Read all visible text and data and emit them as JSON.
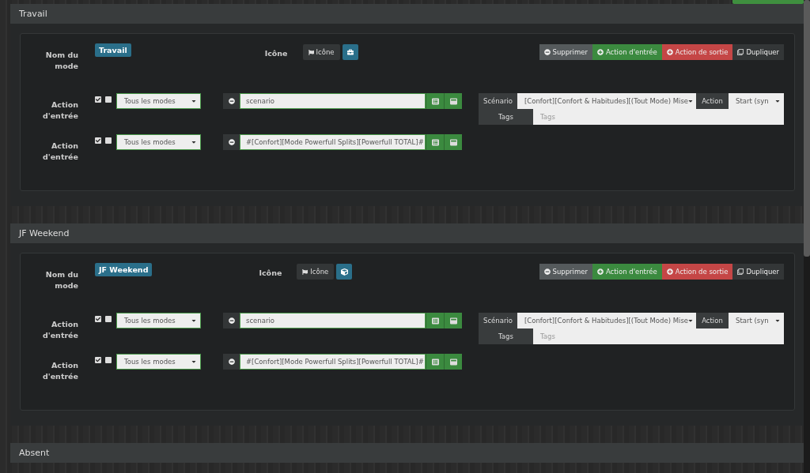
{
  "modes": [
    {
      "title": "Travail",
      "name": "Travail",
      "icon_label": "Icône",
      "icon_button": "Icône",
      "name_label": "Nom du mode",
      "buttons": [
        {
          "kind": "remove",
          "label": "Supprimer"
        },
        {
          "kind": "enter",
          "label": "Action d'entrée"
        },
        {
          "kind": "exit",
          "label": "Action de sortie"
        },
        {
          "kind": "copy",
          "label": "Dupliquer"
        }
      ],
      "actions": [
        {
          "label": "Action d'entrée",
          "checks": [
            {
              "checked": true
            },
            {
              "checked": false
            }
          ],
          "select": "Tous les modes",
          "value": "scenario",
          "scenario": {
            "scenario_label": "Scénario",
            "scenario_select": "[Confort][Confort & Habitudes][(Tout Mode) Mise",
            "action_label": "Action",
            "action_select": "Start (syn",
            "tags_label": "Tags",
            "tags_placeholder": "Tags"
          }
        },
        {
          "label": "Action d'entrée",
          "checks": [
            {
              "checked": true
            },
            {
              "checked": false
            }
          ],
          "select": "Tous les modes",
          "value": "#[Confort][Mode Powerfull Splits][Powerfull TOTAL]#"
        }
      ]
    },
    {
      "title": "JF Weekend",
      "name": "JF Weekend",
      "icon_label": "Icône",
      "icon_button": "Icône",
      "name_label": "Nom du mode",
      "buttons": [
        {
          "kind": "remove",
          "label": "Supprimer"
        },
        {
          "kind": "enter",
          "label": "Action d'entrée"
        },
        {
          "kind": "exit",
          "label": "Action de sortie"
        },
        {
          "kind": "copy",
          "label": "Dupliquer"
        }
      ],
      "actions": [
        {
          "label": "Action d'entrée",
          "checks": [
            {
              "checked": true
            },
            {
              "checked": false
            }
          ],
          "select": "Tous les modes",
          "value": "scenario",
          "scenario": {
            "scenario_label": "Scénario",
            "scenario_select": "[Confort][Confort & Habitudes][(Tout Mode) Mise",
            "action_label": "Action",
            "action_select": "Start (syn",
            "tags_label": "Tags",
            "tags_placeholder": "Tags"
          }
        },
        {
          "label": "Action d'entrée",
          "checks": [
            {
              "checked": true
            },
            {
              "checked": false
            }
          ],
          "select": "Tous les modes",
          "value": "#[Confort][Mode Powerfull Splits][Powerfull TOTAL]#"
        }
      ]
    },
    {
      "title": "Absent"
    }
  ]
}
